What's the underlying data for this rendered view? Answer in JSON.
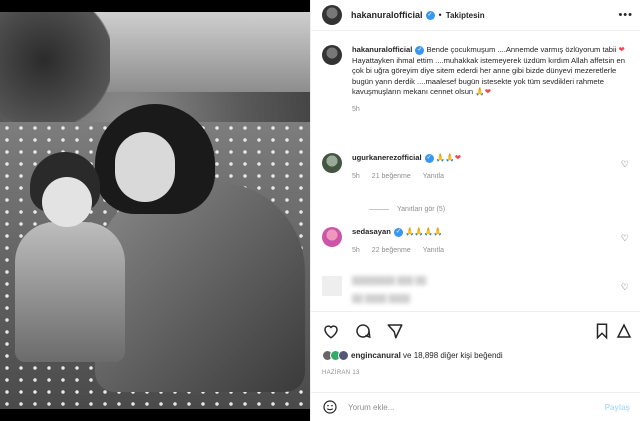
{
  "post": {
    "username": "hakanuralofficial",
    "follow_status": "Takiptesin",
    "caption_username": "hakanuralofficial",
    "caption_text_1": "Bende çocukmuşum ....Annemde varmış özlüyorum tabii",
    "caption_text_2": "Hayattayken ihmal ettim ....muhakkak istemeyerek üzdüm kırdım Allah affetsin en çok bi uğra göreyim diye sitem ederdi her anne gibi bizde dünyevi mezeretlerle bugün yarın derdik ....maalesef bugün istesekte yok tüm sevdikleri rahmete kavuşmuşların mekanı cennet olsun",
    "caption_time": "5h"
  },
  "comments": [
    {
      "username": "ugurkanerezofficial",
      "emojis": "🙏🙏",
      "time": "5h",
      "likes": "21 beğenme",
      "reply": "Yanıtla"
    },
    {
      "username": "sedasayan",
      "emojis": "🙏🙏🙏🙏",
      "time": "5h",
      "likes": "22 beğenme",
      "reply": "Yanıtla"
    }
  ],
  "replies_toggle": "Yanıtları gör (5)",
  "likes": {
    "user": "engincanural",
    "rest": "ve 18,898 diğer kişi beğendi"
  },
  "date": "HAZİRAN 13",
  "composer": {
    "placeholder": "Yorum ekle...",
    "post_label": "Paylaş"
  },
  "colors": {
    "verified": "#3897f0",
    "heart": "#ed4956",
    "post_disabled": "#b2dffc"
  }
}
